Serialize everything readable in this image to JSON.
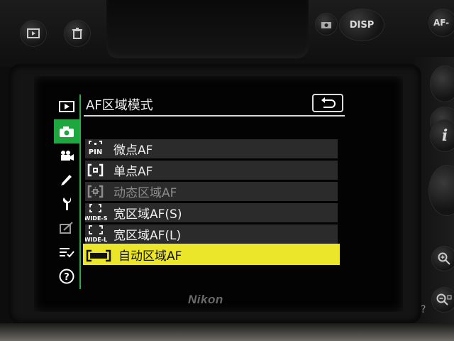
{
  "camera": {
    "disp_button": "DISP",
    "af_button": "AF-",
    "info_button": "i",
    "brand": "Nikon",
    "help_mark": "?"
  },
  "menu": {
    "title": "AF区域模式",
    "tabs": [
      {
        "name": "playback-menu",
        "icon": "playback-icon",
        "active": false
      },
      {
        "name": "photo-shooting-menu",
        "icon": "camera-icon",
        "active": true
      },
      {
        "name": "movie-shooting-menu",
        "icon": "movie-camera-icon",
        "active": false
      },
      {
        "name": "custom-settings-menu",
        "icon": "pencil-icon",
        "active": false
      },
      {
        "name": "setup-menu",
        "icon": "wrench-icon",
        "active": false
      },
      {
        "name": "retouch-menu",
        "icon": "retouch-icon",
        "active": false
      },
      {
        "name": "my-menu",
        "icon": "checklist-icon",
        "active": false
      },
      {
        "name": "help",
        "icon": "help-icon",
        "active": false
      }
    ],
    "options": [
      {
        "label": "微点AF",
        "icon": "pin-point-af-icon",
        "icon_text": "PIN",
        "state": "normal"
      },
      {
        "label": "单点AF",
        "icon": "single-point-af-icon",
        "icon_text": "",
        "state": "normal"
      },
      {
        "label": "动态区域AF",
        "icon": "dynamic-area-af-icon",
        "icon_text": "",
        "state": "disabled"
      },
      {
        "label": "宽区域AF(S)",
        "icon": "wide-area-s-icon",
        "icon_text": "WIDE-S",
        "state": "normal"
      },
      {
        "label": "宽区域AF(L)",
        "icon": "wide-area-l-icon",
        "icon_text": "WIDE-L",
        "state": "normal"
      },
      {
        "label": "自动区域AF",
        "icon": "auto-area-af-icon",
        "icon_text": "",
        "state": "selected"
      }
    ]
  },
  "colors": {
    "active_tab": "#1fa73f",
    "selection": "#ece62b",
    "row_background": "#2b2b2b"
  }
}
